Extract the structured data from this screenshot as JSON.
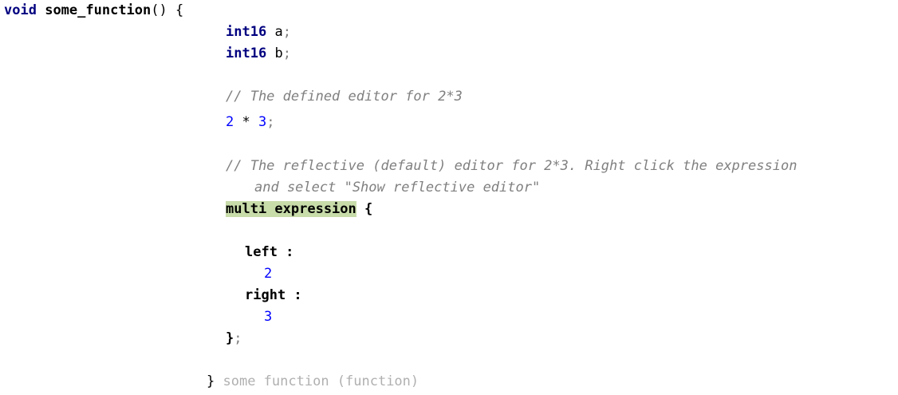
{
  "header": {
    "return_type": "void",
    "function_name": "some_function",
    "params": "()",
    "open_brace": "{"
  },
  "declarations": [
    {
      "type": "int16",
      "name": "a",
      "semi": ";"
    },
    {
      "type": "int16",
      "name": "b",
      "semi": ";"
    }
  ],
  "comment_defined": "// The defined editor for 2*3",
  "expression": {
    "left": "2",
    "op": "*",
    "right": "3",
    "semi": ";"
  },
  "comment_reflective_line1": "// The reflective (default) editor for 2*3. Right click the expression",
  "comment_reflective_line2": "and select \"Show reflective editor\"",
  "reflective": {
    "concept": "multi expression",
    "open": "{",
    "left_label": "left :",
    "left_value": "2",
    "right_label": "right :",
    "right_value": "3",
    "close": "}",
    "close_semi": ";"
  },
  "footer": {
    "close_brace": "}",
    "annotation": "some function (function)"
  }
}
